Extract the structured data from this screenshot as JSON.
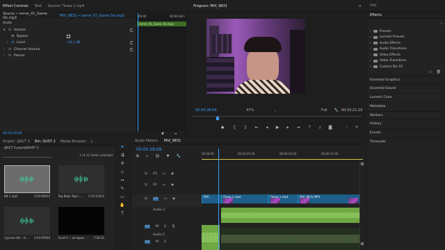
{
  "effect_controls": {
    "tabs": [
      "Effect Controls",
      "Text",
      "Source: Пожа 1.mp4"
    ],
    "source": "Source • nerve_01_Game On.mp3",
    "clip": "MVI_9831 • nerve_01_Game On.mp3",
    "mini_tc": [
      "00:00",
      "00:00:28:1"
    ],
    "mini_clip": "nerve_01_Game On.mp3",
    "section": "Audio",
    "volume": "Volume",
    "bypass": "Bypass",
    "level_label": "Level",
    "level_value": "-24,1 dB",
    "channel_volume": "Channel Volume",
    "panner": "Panner",
    "fx": "fx",
    "footer_tc": "00:00:28:09"
  },
  "program": {
    "title": "Program: MVI_9831",
    "timecode": "00:00:28:09",
    "zoom": "47%",
    "quality": "Full",
    "duration": "00:03:21:19"
  },
  "project": {
    "tabs": [
      "Project: ДАСТ 2",
      "Bin: DUST 2",
      "Media Browser",
      "L"
    ],
    "path": "ДАСТ 2.prproj\\DUST 2",
    "count": "1 of 12 items selected",
    "items": [
      {
        "name": "EN 1.mp3",
        "dur": "3:59:06012",
        "kind": "audio"
      },
      {
        "name": "Big Baby Tape -...",
        "dur": "3:15:41812",
        "kind": "audio"
      },
      {
        "name": "Cypress Hill - In...",
        "dur": "3:54:05928",
        "kind": "audio"
      },
      {
        "name": "Dust II — история ...",
        "dur": "7:44:32",
        "kind": "video"
      }
    ]
  },
  "timeline": {
    "tabs": [
      "Audio Meters",
      "MVI_9831"
    ],
    "timecode": "00:00:28:09",
    "ruler": [
      "00:28:00",
      "00:00:29:00",
      "00:00:30:00",
      "00:00:31:00"
    ],
    "video_tracks": [
      "V3",
      "V2",
      "V1"
    ],
    "audio_tracks": [
      "A1",
      "A2"
    ],
    "audio_names": [
      "Audio 2",
      "Audio 1"
    ],
    "clips": [
      "MVI...",
      "Пожа 1.mp4",
      "Пожа 1.mp4",
      "MVI_9831.MP4"
    ]
  },
  "right": {
    "info": "Info",
    "effects": "Effects",
    "folders": [
      "Presets",
      "Lumetri Presets",
      "Audio Effects",
      "Audio Transitions",
      "Video Effects",
      "Video Transitions",
      "Custom Bin 01"
    ],
    "sections": [
      "Essential Graphics",
      "Essential Sound",
      "Lumetri Color",
      "Metadata",
      "Markers",
      "History",
      "Events",
      "Timecode"
    ]
  }
}
